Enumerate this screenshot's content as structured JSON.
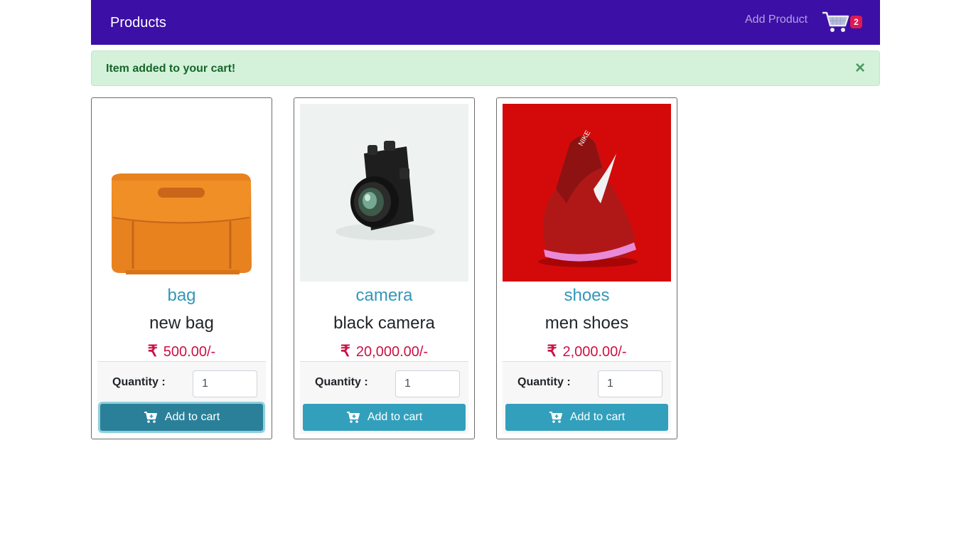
{
  "nav": {
    "brand": "Products",
    "add_product": "Add Product",
    "cart_count": "2"
  },
  "alert": {
    "message": "Item added to your cart!",
    "close": "×"
  },
  "currency_symbol": "₹",
  "products": [
    {
      "category": "bag",
      "name": "new bag",
      "price": "500.00/-",
      "quantity_label": "Quantity :",
      "quantity": "1",
      "button": "Add to cart"
    },
    {
      "category": "camera",
      "name": "black camera",
      "price": "20,000.00/-",
      "quantity_label": "Quantity :",
      "quantity": "1",
      "button": "Add to cart"
    },
    {
      "category": "shoes",
      "name": "men shoes",
      "price": "2,000.00/-",
      "quantity_label": "Quantity :",
      "quantity": "1",
      "button": "Add to cart"
    }
  ],
  "colors": {
    "navbar": "#3c0fa6",
    "alert_bg": "#d4f2da",
    "category": "#3397b9",
    "price": "#cc1146",
    "button": "#32a0bc"
  }
}
